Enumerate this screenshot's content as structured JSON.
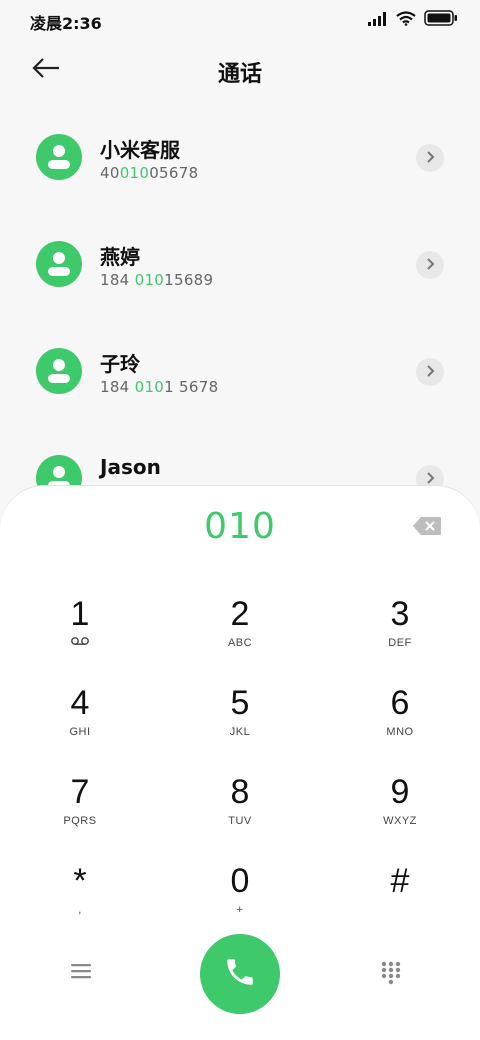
{
  "status_bar": {
    "time": "凌晨2:36"
  },
  "header": {
    "title": "通话"
  },
  "contacts": [
    {
      "name": "小米客服",
      "number_pre": "40",
      "number_match": "010",
      "number_post": "05678"
    },
    {
      "name": "燕婷",
      "number_pre": "184 ",
      "number_match": "010",
      "number_post": "15689"
    },
    {
      "name": "子玲",
      "number_pre": "184 ",
      "number_match": "010",
      "number_post": "1 5678"
    },
    {
      "name": "Jason",
      "number_pre": "",
      "number_match": "",
      "number_post": ""
    }
  ],
  "dialpad": {
    "dialed": "010",
    "keys": [
      {
        "digit": "1",
        "sub": ""
      },
      {
        "digit": "2",
        "sub": "ABC"
      },
      {
        "digit": "3",
        "sub": "DEF"
      },
      {
        "digit": "4",
        "sub": "GHI"
      },
      {
        "digit": "5",
        "sub": "JKL"
      },
      {
        "digit": "6",
        "sub": "MNO"
      },
      {
        "digit": "7",
        "sub": "PQRS"
      },
      {
        "digit": "8",
        "sub": "TUV"
      },
      {
        "digit": "9",
        "sub": "WXYZ"
      },
      {
        "digit": "*",
        "sub": ","
      },
      {
        "digit": "0",
        "sub": "+"
      },
      {
        "digit": "#",
        "sub": ""
      }
    ]
  },
  "icons": {
    "back": "arrow-left-icon",
    "signal": "signal-icon",
    "wifi": "wifi-icon",
    "battery": "battery-icon",
    "chevron": "chevron-right-icon",
    "backspace": "backspace-icon",
    "voicemail": "voicemail-icon",
    "menu": "menu-icon",
    "phone": "phone-icon",
    "keypad": "keypad-icon"
  },
  "colors": {
    "accent": "#3ec96a",
    "background": "#f7f7f7",
    "panel": "#ffffff"
  }
}
